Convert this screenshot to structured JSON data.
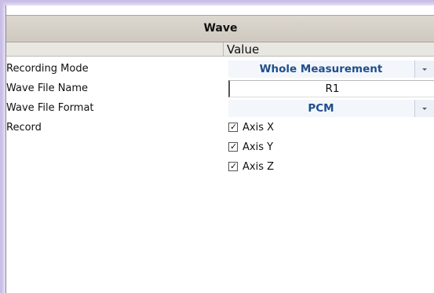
{
  "panel": {
    "title": "Wave",
    "value_header": "Value"
  },
  "rows": {
    "recording_mode": {
      "label": "Recording Mode",
      "value": "Whole Measurement"
    },
    "wave_file_name": {
      "label": "Wave File Name",
      "value": "R1"
    },
    "wave_file_format": {
      "label": "Wave File Format",
      "value": "PCM"
    },
    "record": {
      "label": "Record",
      "options": [
        {
          "label": "Axis X",
          "checked": true
        },
        {
          "label": "Axis Y",
          "checked": true
        },
        {
          "label": "Axis Z",
          "checked": true
        }
      ]
    }
  },
  "colors": {
    "title_bar": "#cfc9c0",
    "combo_text": "#1f4e8c",
    "frame_glow": "#c9bfe6"
  },
  "icons": {
    "dropdown": "chevron-down-icon",
    "check": "checkmark-icon"
  }
}
